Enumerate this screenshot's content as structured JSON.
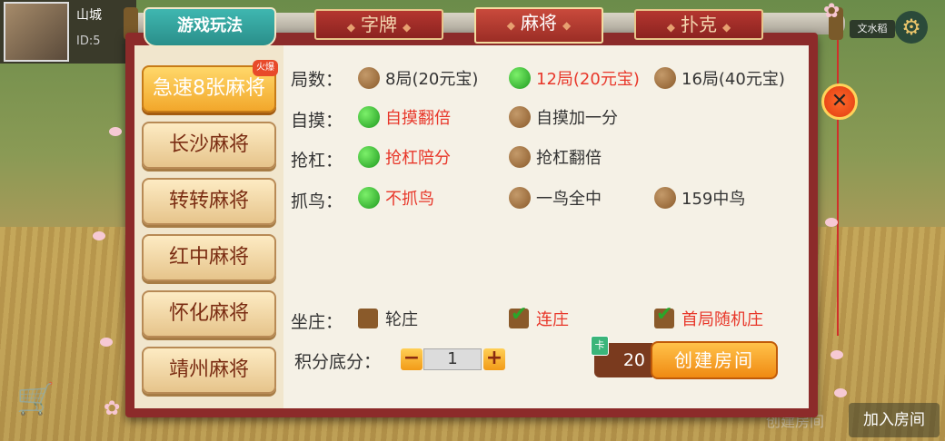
{
  "background": {
    "user_name": "山城",
    "user_id": "ID:5",
    "top_right_tag": "文水稻",
    "bottom_create": "创建房间",
    "bottom_join": "加入房间"
  },
  "header": {
    "gameplay_tab": "游戏玩法",
    "tabs": [
      {
        "label": "字牌",
        "active": false
      },
      {
        "label": "麻将",
        "active": true
      },
      {
        "label": "扑克",
        "active": false
      }
    ]
  },
  "sidebar": {
    "items": [
      {
        "label": "急速8张麻将",
        "active": true,
        "badge": "火爆"
      },
      {
        "label": "长沙麻将",
        "active": false
      },
      {
        "label": "转转麻将",
        "active": false
      },
      {
        "label": "红中麻将",
        "active": false
      },
      {
        "label": "怀化麻将",
        "active": false
      },
      {
        "label": "靖州麻将",
        "active": false
      }
    ]
  },
  "options": {
    "rounds": {
      "label": "局数：",
      "choices": [
        {
          "text": "8局(20元宝)",
          "selected": false
        },
        {
          "text": "12局(20元宝)",
          "selected": true
        },
        {
          "text": "16局(40元宝)",
          "selected": false
        }
      ]
    },
    "self_draw": {
      "label": "自摸：",
      "choices": [
        {
          "text": "自摸翻倍",
          "selected": true
        },
        {
          "text": "自摸加一分",
          "selected": false
        }
      ]
    },
    "rob_kong": {
      "label": "抢杠：",
      "choices": [
        {
          "text": "抢杠陪分",
          "selected": true
        },
        {
          "text": "抢杠翻倍",
          "selected": false
        }
      ]
    },
    "bird": {
      "label": "抓鸟：",
      "choices": [
        {
          "text": "不抓鸟",
          "selected": true
        },
        {
          "text": "一鸟全中",
          "selected": false
        },
        {
          "text": "159中鸟",
          "selected": false
        }
      ]
    },
    "dealer": {
      "label": "坐庄：",
      "choices": [
        {
          "text": "轮庄",
          "checked": false
        },
        {
          "text": "连庄",
          "checked": true
        },
        {
          "text": "首局随机庄",
          "checked": true
        }
      ]
    },
    "base_score": {
      "label": "积分底分：",
      "minus": "−",
      "value": "1",
      "plus": "+"
    }
  },
  "footer": {
    "cost": "20",
    "cost_icon": "卡",
    "create_label": "创建房间"
  },
  "icons": {
    "close": "close-icon",
    "gear": "gear-icon"
  },
  "colors": {
    "frame": "#8c2b2a",
    "selected_text": "#e8372a",
    "radio_on": "#1e9a1e",
    "create_button": "#f08a12"
  }
}
